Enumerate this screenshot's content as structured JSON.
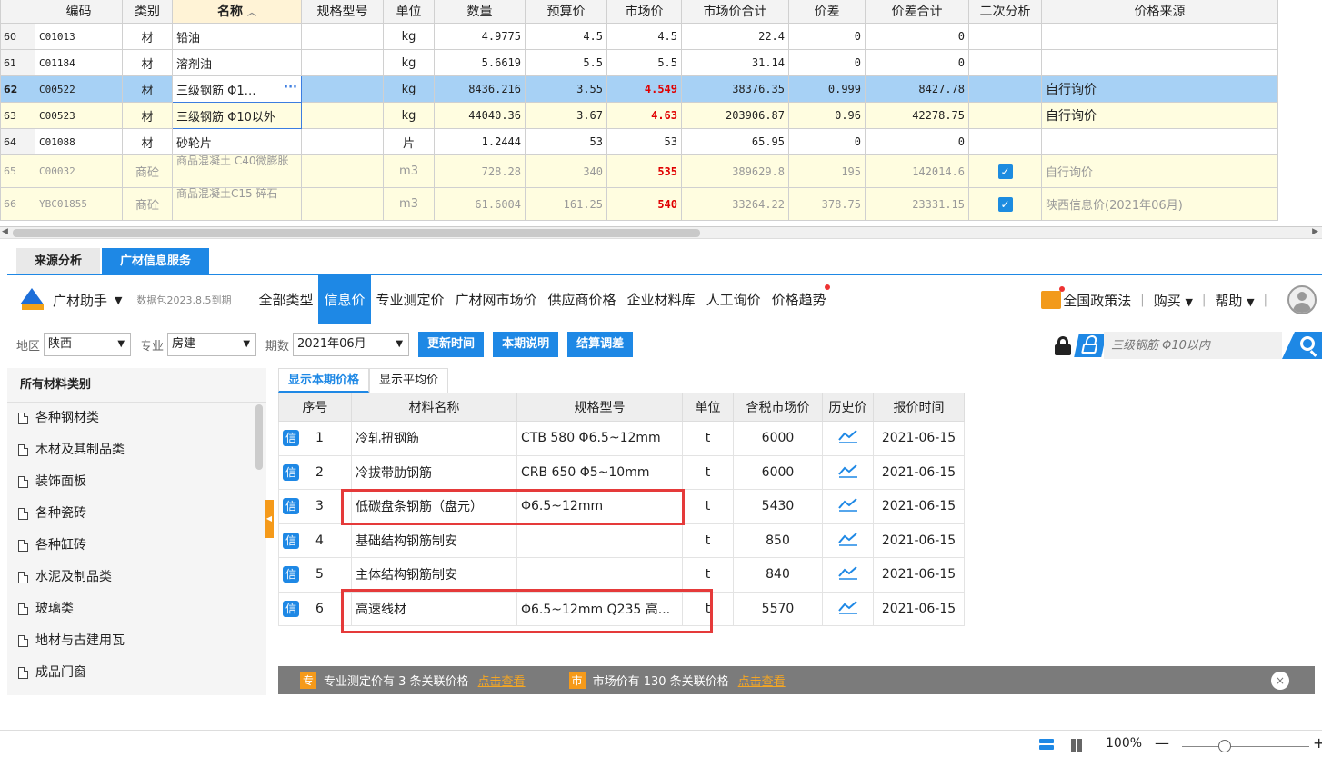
{
  "grid": {
    "headers": [
      "编码",
      "类别",
      "名称",
      "规格型号",
      "单位",
      "数量",
      "预算价",
      "市场价",
      "市场价合计",
      "价差",
      "价差合计",
      "二次分析",
      "价格来源"
    ],
    "rows": [
      {
        "rn": "60",
        "code": "C01013",
        "cat": "材",
        "name": "铅油",
        "spec": "",
        "unit": "kg",
        "qty": "4.9775",
        "budget": "4.5",
        "market": "4.5",
        "total": "22.4",
        "diff": "0",
        "difftotal": "0",
        "chk": "",
        "src": ""
      },
      {
        "rn": "61",
        "code": "C01184",
        "cat": "材",
        "name": "溶剂油",
        "spec": "",
        "unit": "kg",
        "qty": "5.6619",
        "budget": "5.5",
        "market": "5.5",
        "total": "31.14",
        "diff": "0",
        "difftotal": "0",
        "chk": "",
        "src": ""
      },
      {
        "rn": "62",
        "code": "C00522",
        "cat": "材",
        "name": "三级钢筋 Φ1…",
        "spec": "",
        "unit": "kg",
        "qty": "8436.216",
        "budget": "3.55",
        "market": "4.549",
        "total": "38376.35",
        "diff": "0.999",
        "difftotal": "8427.78",
        "chk": "",
        "src": "自行询价"
      },
      {
        "rn": "63",
        "code": "C00523",
        "cat": "材",
        "name": "三级钢筋 Φ10以外",
        "spec": "",
        "unit": "kg",
        "qty": "44040.36",
        "budget": "3.67",
        "market": "4.63",
        "total": "203906.87",
        "diff": "0.96",
        "difftotal": "42278.75",
        "chk": "",
        "src": "自行询价"
      },
      {
        "rn": "64",
        "code": "C01088",
        "cat": "材",
        "name": "砂轮片",
        "spec": "",
        "unit": "片",
        "qty": "1.2444",
        "budget": "53",
        "market": "53",
        "total": "65.95",
        "diff": "0",
        "difftotal": "0",
        "chk": "",
        "src": ""
      },
      {
        "rn": "65",
        "code": "C00032",
        "cat": "商砼",
        "name": "商品混凝土 C40微膨胀",
        "spec": "",
        "unit": "m3",
        "qty": "728.28",
        "budget": "340",
        "market": "535",
        "total": "389629.8",
        "diff": "195",
        "difftotal": "142014.6",
        "chk": "✓",
        "src": "自行询价"
      },
      {
        "rn": "66",
        "code": "YBC01855",
        "cat": "商砼",
        "name": "商品混凝土C15 碎石",
        "spec": "",
        "unit": "m3",
        "qty": "61.6004",
        "budget": "161.25",
        "market": "540",
        "total": "33264.22",
        "diff": "378.75",
        "difftotal": "23331.15",
        "chk": "✓",
        "src": "陕西信息价(2021年06月)"
      }
    ],
    "ellipsis": "···"
  },
  "bottom_tabs": [
    "来源分析",
    "广材信息服务"
  ],
  "toolbar": {
    "helper": "广材助手",
    "helper_caret": "▼",
    "dbver": "数据包2023.8.5到期",
    "tabs": [
      "全部类型",
      "信息价",
      "专业测定价",
      "广材网市场价",
      "供应商价格",
      "企业材料库",
      "人工询价",
      "价格趋势"
    ],
    "policy": "全国政策法",
    "buy": "购买",
    "help": "帮助",
    "caret": "▼",
    "sep": "|"
  },
  "filters": {
    "region_label": "地区",
    "region": "陕西",
    "major_label": "专业",
    "major": "房建",
    "period_label": "期数",
    "period": "2021年06月",
    "caret": "▼",
    "btn_update": "更新时间",
    "btn_note": "本期说明",
    "btn_settle": "结算调差",
    "search_placeholder": "三级钢筋 Φ10以内"
  },
  "categories": {
    "title": "所有材料类别",
    "items": [
      "各种钢材类",
      "木材及其制品类",
      "装饰面板",
      "各种瓷砖",
      "各种缸砖",
      "水泥及制品类",
      "玻璃类",
      "地材与古建用瓦",
      "成品门窗"
    ]
  },
  "price_tabs": [
    "显示本期价格",
    "显示平均价"
  ],
  "price_table": {
    "headers": [
      "序号",
      "材料名称",
      "规格型号",
      "单位",
      "含税市场价",
      "历史价",
      "报价时间"
    ],
    "badge": "信",
    "rows": [
      {
        "no": "1",
        "name": "冷轧扭钢筋",
        "spec": "CTB 580 Φ6.5~12mm",
        "unit": "t",
        "price": "6000",
        "date": "2021-06-15"
      },
      {
        "no": "2",
        "name": "冷拔带肋钢筋",
        "spec": "CRB 650 Φ5~10mm",
        "unit": "t",
        "price": "6000",
        "date": "2021-06-15"
      },
      {
        "no": "3",
        "name": "低碳盘条钢筋（盘元）",
        "spec": "Φ6.5~12mm",
        "unit": "t",
        "price": "5430",
        "date": "2021-06-15"
      },
      {
        "no": "4",
        "name": "基础结构钢筋制安",
        "spec": "",
        "unit": "t",
        "price": "850",
        "date": "2021-06-15"
      },
      {
        "no": "5",
        "name": "主体结构钢筋制安",
        "spec": "",
        "unit": "t",
        "price": "840",
        "date": "2021-06-15"
      },
      {
        "no": "6",
        "name": "高速线材",
        "spec": "Φ6.5~12mm Q235 高...",
        "unit": "t",
        "price": "5570",
        "date": "2021-06-15"
      }
    ]
  },
  "footer": {
    "tag1": "专",
    "text1": "专业测定价有 3 条关联价格",
    "link1": "点击查看",
    "tag2": "市",
    "text2": "市场价有 130 条关联价格",
    "link2": "点击查看",
    "close": "×"
  },
  "status": {
    "zoom": "100%",
    "minus": "—",
    "plus": "+"
  },
  "colors": {
    "accent": "#1e88e5",
    "highlight_box": "#e53a3a",
    "price_red": "#e00000",
    "selected_row": "#a7d1f5"
  }
}
